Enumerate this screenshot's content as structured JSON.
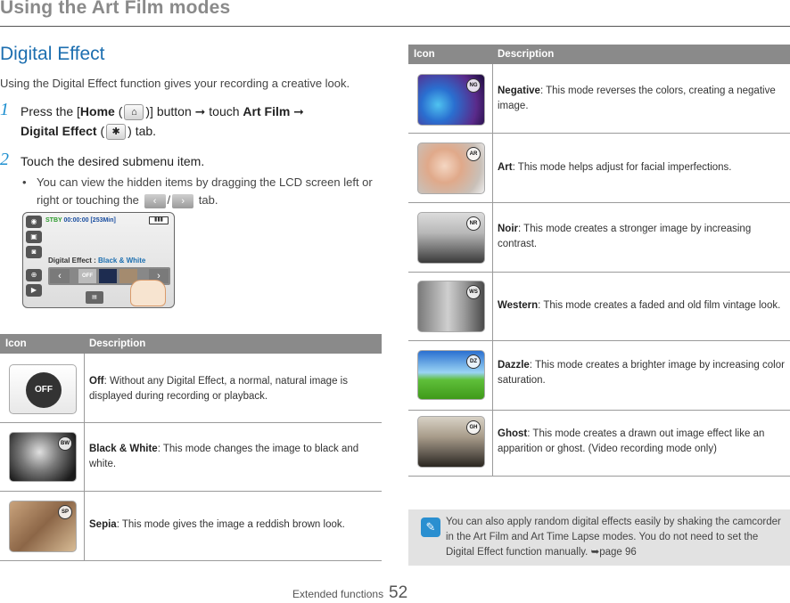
{
  "header": {
    "title": "Using the Art Film modes"
  },
  "section": {
    "title": "Digital Effect",
    "intro": "Using the Digital Effect function gives your recording a creative look."
  },
  "steps": [
    {
      "num": "1",
      "part1": "Press the [",
      "home": "Home",
      "part2": ")] button ➞ touch ",
      "artfilm": "Art Film",
      "part3": " ➞",
      "digital": "Digital Effect",
      "part4": ") tab."
    },
    {
      "num": "2",
      "text": "Touch the desired submenu item."
    }
  ],
  "bullet": {
    "part1": "You can view the hidden items by dragging the LCD screen left or right or touching the",
    "sep": "/",
    "part2": "tab."
  },
  "lcd": {
    "stby": "STBY",
    "time": "00:00:00 [253Min]",
    "label": "Digital Effect : ",
    "value": "Black & White",
    "off": "OFF"
  },
  "left_table": {
    "col_icon": "Icon",
    "col_desc": "Description",
    "rows": [
      {
        "name": "Off",
        "desc": ": Without any Digital Effect, a normal, natural image is displayed during recording or playback.",
        "icon": "off-icon"
      },
      {
        "name": "Black & White",
        "desc": ": This mode changes the image to black and white.",
        "icon": "black-white-thumbnail"
      },
      {
        "name": "Sepia",
        "desc": ": This mode gives the image a reddish brown look.",
        "icon": "sepia-thumbnail"
      }
    ]
  },
  "right_table": {
    "col_icon": "Icon",
    "col_desc": "Description",
    "rows": [
      {
        "name": "Negative",
        "desc": ": This mode reverses the colors, creating a negative image.",
        "icon": "negative-thumbnail"
      },
      {
        "name": "Art",
        "desc": ": This mode helps adjust for facial imperfections.",
        "icon": "art-thumbnail"
      },
      {
        "name": "Noir",
        "desc": ": This mode creates a stronger image by increasing contrast.",
        "icon": "noir-thumbnail"
      },
      {
        "name": "Western",
        "desc": ": This mode creates a faded and old film vintage look.",
        "icon": "western-thumbnail"
      },
      {
        "name": "Dazzle",
        "desc": ": This mode creates a brighter image by increasing color saturation.",
        "icon": "dazzle-thumbnail"
      },
      {
        "name": "Ghost",
        "desc": ": This mode creates a drawn out image effect like an apparition or ghost. (Video recording mode only)",
        "icon": "ghost-thumbnail"
      }
    ]
  },
  "note": {
    "text": "You can also apply random digital effects easily by shaking the camcorder in the Art Film and Art Time Lapse modes. You do not need to set the Digital Effect function manually. ➥page 96"
  },
  "footer": {
    "label": "Extended functions",
    "page": "52"
  },
  "colors": {
    "accent": "#1d6fb0",
    "table_header": "#8a8a8a",
    "note_bg": "#e2e2e2"
  }
}
